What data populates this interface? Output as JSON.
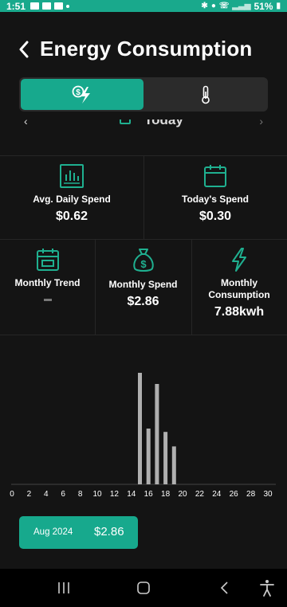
{
  "status_bar": {
    "time": "1:51",
    "battery": "51%"
  },
  "header": {
    "title": "Energy Consumption"
  },
  "toggle": {
    "options": [
      "cost-energy-icon",
      "thermometer-icon"
    ],
    "selected_index": 0
  },
  "date_nav": {
    "label": "Today"
  },
  "stats": {
    "avg_daily_spend": {
      "label": "Avg. Daily Spend",
      "value": "$0.62",
      "icon": "chart-bar-icon"
    },
    "todays_spend": {
      "label": "Today's Spend",
      "value": "$0.30",
      "icon": "calendar-icon"
    },
    "monthly_trend": {
      "label": "Monthly Trend",
      "value": "–",
      "icon": "calendar-trend-icon"
    },
    "monthly_spend": {
      "label": "Monthly Spend",
      "value": "$2.86",
      "icon": "money-bag-icon"
    },
    "monthly_consumption": {
      "label": "Monthly Consumption",
      "value": "7.88kwh",
      "icon": "lightning-icon"
    }
  },
  "chart_data": {
    "type": "bar",
    "x_ticks": [
      0,
      2,
      4,
      6,
      8,
      10,
      12,
      14,
      16,
      18,
      20,
      22,
      24,
      26,
      28,
      30
    ],
    "bars": [
      {
        "day": 15,
        "value": 1.0
      },
      {
        "day": 16,
        "value": 0.5
      },
      {
        "day": 17,
        "value": 0.9
      },
      {
        "day": 18,
        "value": 0.47
      },
      {
        "day": 19,
        "value": 0.34
      }
    ],
    "bar_color": "#b0b0b0",
    "title": "",
    "xlabel": "",
    "ylabel": ""
  },
  "summary": {
    "month": "Aug 2024",
    "amount": "$2.86"
  },
  "colors": {
    "accent": "#17a98d",
    "background": "#141414"
  }
}
